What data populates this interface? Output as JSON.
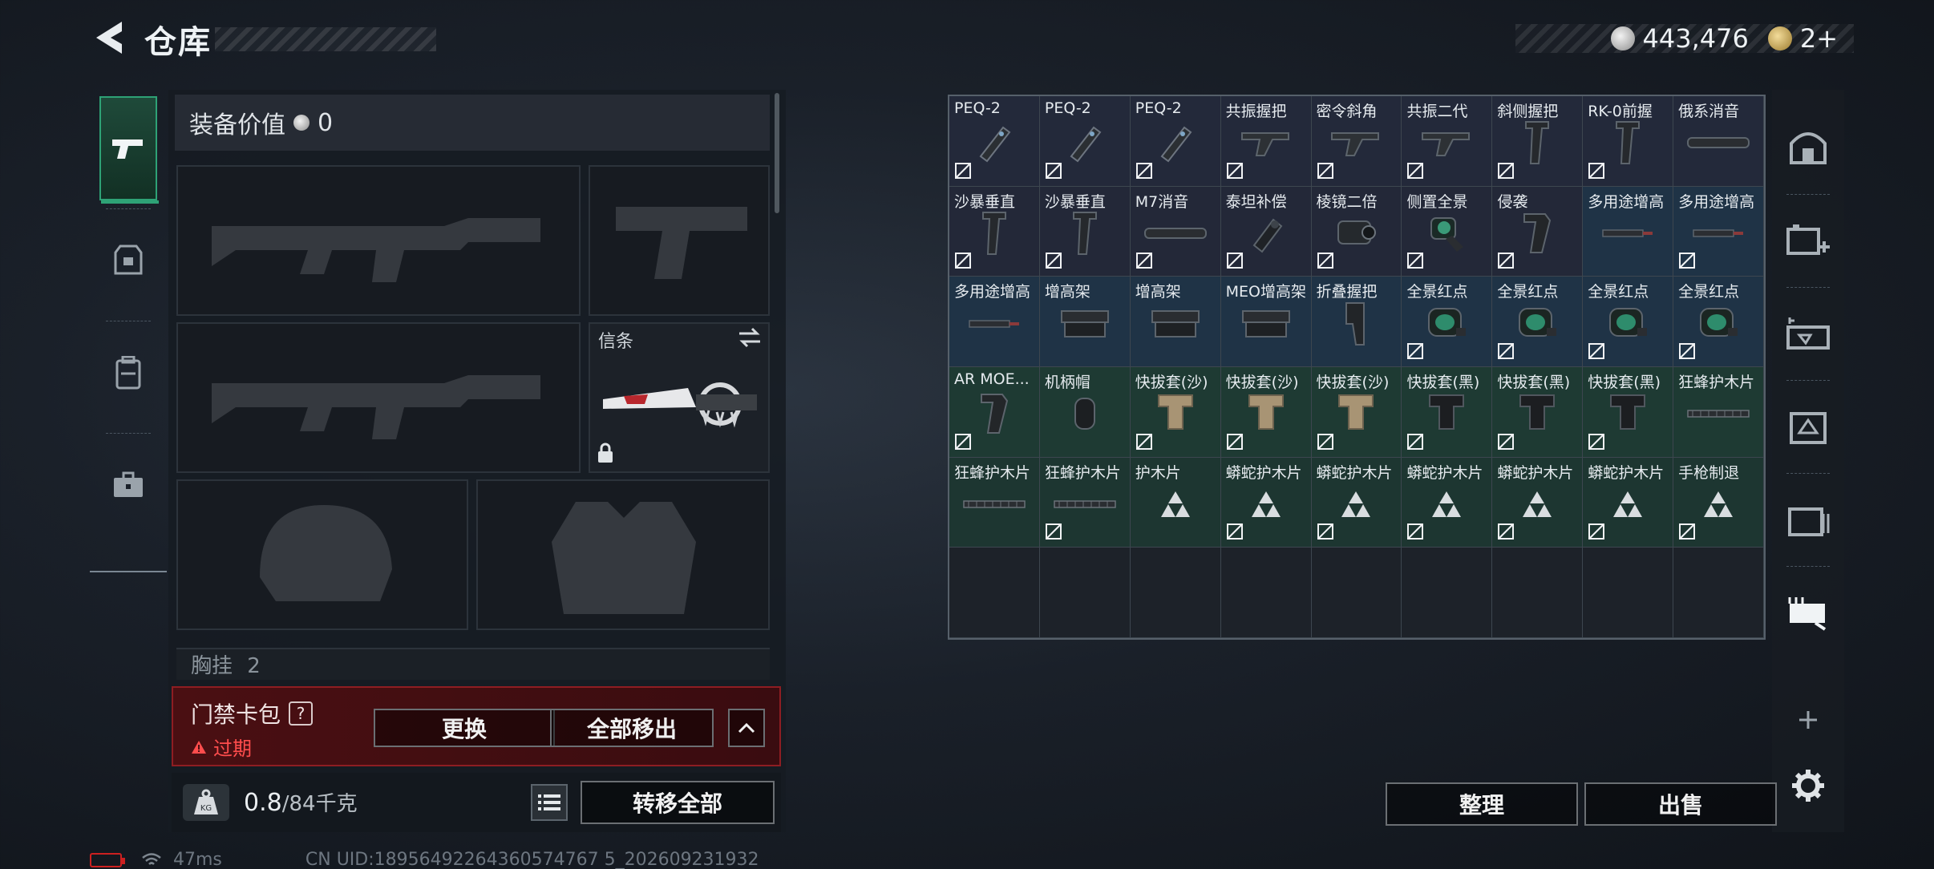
{
  "header": {
    "title": "仓库",
    "silver_balance": "443,476",
    "gold_badge": "2+"
  },
  "loadout": {
    "value_label": "装备价值",
    "value_amount": "0",
    "knife_label": "信条",
    "chest_label": "胸挂",
    "chest_count": "2"
  },
  "keycard": {
    "label": "门禁卡包",
    "help": "?",
    "status": "过期",
    "replace_label": "更换",
    "move_all_label": "全部移出"
  },
  "weight": {
    "current": "0.8",
    "max": "/84千克",
    "transfer_label": "转移全部"
  },
  "status_bar": {
    "ping": "47ms",
    "uid": "CN UID:18956492264360574767 5_202609231932"
  },
  "storage": {
    "items": [
      {
        "name": "PEQ-2",
        "icon": "laser-module"
      },
      {
        "name": "PEQ-2",
        "icon": "laser-module"
      },
      {
        "name": "PEQ-2",
        "icon": "laser-module"
      },
      {
        "name": "共振握把",
        "icon": "angled-grip"
      },
      {
        "name": "密令斜角",
        "icon": "angled-grip"
      },
      {
        "name": "共振二代",
        "icon": "angled-grip"
      },
      {
        "name": "斜侧握把",
        "icon": "vertical-grip"
      },
      {
        "name": "RK-0前握",
        "icon": "vertical-grip"
      },
      {
        "name": "俄系消音",
        "icon": "suppressor"
      },
      {
        "name": "沙暴垂直",
        "icon": "vertical-grip"
      },
      {
        "name": "沙暴垂直",
        "icon": "vertical-grip"
      },
      {
        "name": "M7消音",
        "icon": "suppressor"
      },
      {
        "name": "泰坦补偿",
        "icon": "compensator"
      },
      {
        "name": "棱镜二倍",
        "icon": "prism-scope"
      },
      {
        "name": "侧置全景",
        "icon": "side-holo"
      },
      {
        "name": "侵袭",
        "icon": "pistol-grip"
      },
      {
        "name": "多用途增高",
        "icon": "rail-riser"
      },
      {
        "name": "多用途增高",
        "icon": "rail-riser"
      },
      {
        "name": "多用途增高",
        "icon": "rail-riser"
      },
      {
        "name": "增高架",
        "icon": "riser-mount"
      },
      {
        "name": "增高架",
        "icon": "riser-mount"
      },
      {
        "name": "MEO增高架",
        "icon": "riser-mount"
      },
      {
        "name": "折叠握把",
        "icon": "folding-grip"
      },
      {
        "name": "全景红点",
        "icon": "red-dot"
      },
      {
        "name": "全景红点",
        "icon": "red-dot"
      },
      {
        "name": "全景红点",
        "icon": "red-dot"
      },
      {
        "name": "全景红点",
        "icon": "red-dot"
      },
      {
        "name": "AR MOE...",
        "icon": "pistol-grip"
      },
      {
        "name": "机柄帽",
        "icon": "cap"
      },
      {
        "name": "快拔套(沙)",
        "icon": "holster-tan"
      },
      {
        "name": "快拔套(沙)",
        "icon": "holster-tan"
      },
      {
        "name": "快拔套(沙)",
        "icon": "holster-tan"
      },
      {
        "name": "快拔套(黑)",
        "icon": "holster-black"
      },
      {
        "name": "快拔套(黑)",
        "icon": "holster-black"
      },
      {
        "name": "快拔套(黑)",
        "icon": "holster-black"
      },
      {
        "name": "狂蜂护木片",
        "icon": "rail-panel"
      },
      {
        "name": "狂蜂护木片",
        "icon": "rail-panel"
      },
      {
        "name": "狂蜂护木片",
        "icon": "rail-panel"
      },
      {
        "name": "护木片",
        "icon": "triforce"
      },
      {
        "name": "蟒蛇护木片",
        "icon": "triforce"
      },
      {
        "name": "蟒蛇护木片",
        "icon": "triforce"
      },
      {
        "name": "蟒蛇护木片",
        "icon": "triforce"
      },
      {
        "name": "蟒蛇护木片",
        "icon": "triforce"
      },
      {
        "name": "蟒蛇护木片",
        "icon": "triforce"
      },
      {
        "name": "手枪制退",
        "icon": "triforce"
      }
    ],
    "no_trade_flags": [
      true,
      true,
      true,
      true,
      true,
      true,
      true,
      true,
      false,
      true,
      true,
      true,
      true,
      true,
      true,
      true,
      false,
      true,
      false,
      false,
      false,
      false,
      false,
      true,
      true,
      true,
      true,
      true,
      false,
      true,
      true,
      true,
      true,
      true,
      true,
      false,
      false,
      true,
      false,
      true,
      true,
      true,
      true,
      true,
      true
    ],
    "row_tints": [
      "#23293a",
      "#232838",
      "#1f3346",
      "#1e3a33",
      "#1d3631"
    ],
    "sort_label": "整理",
    "sell_label": "出售"
  },
  "colors": {
    "accent_green": "#2ea276",
    "keycard_red": "#8e1d22",
    "expired_red": "#ff4d4d"
  }
}
